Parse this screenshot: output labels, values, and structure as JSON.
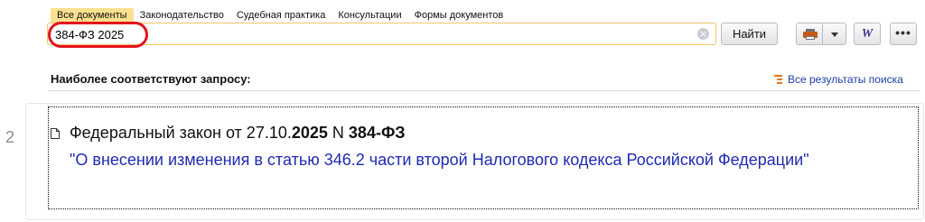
{
  "tabs": [
    {
      "label": "Все документы",
      "active": true
    },
    {
      "label": "Законодательство"
    },
    {
      "label": "Судебная практика"
    },
    {
      "label": "Консультации"
    },
    {
      "label": "Формы документов"
    }
  ],
  "search": {
    "value": "384-ФЗ 2025",
    "placeholder": ""
  },
  "toolbar": {
    "find_label": "Найти",
    "word_icon": "W",
    "more_icon": "•••"
  },
  "results_header": {
    "title": "Наиболее соответствуют запросу:",
    "all_results_label": "Все результаты поиска"
  },
  "results": [
    {
      "number": "2",
      "title_plain_1": "Федеральный закон от 27.10.",
      "title_bold_1": "2025",
      "title_plain_2": " N ",
      "title_bold_2": "384-ФЗ",
      "link": "\"О внесении изменения в статью 346.2 части второй Налогового кодекса Российской Федерации\""
    }
  ],
  "colors": {
    "active_tab": "#fbe18f",
    "highlight_ring": "#e3141b",
    "link": "#1f2bb0",
    "accent": "#e07a1f"
  }
}
